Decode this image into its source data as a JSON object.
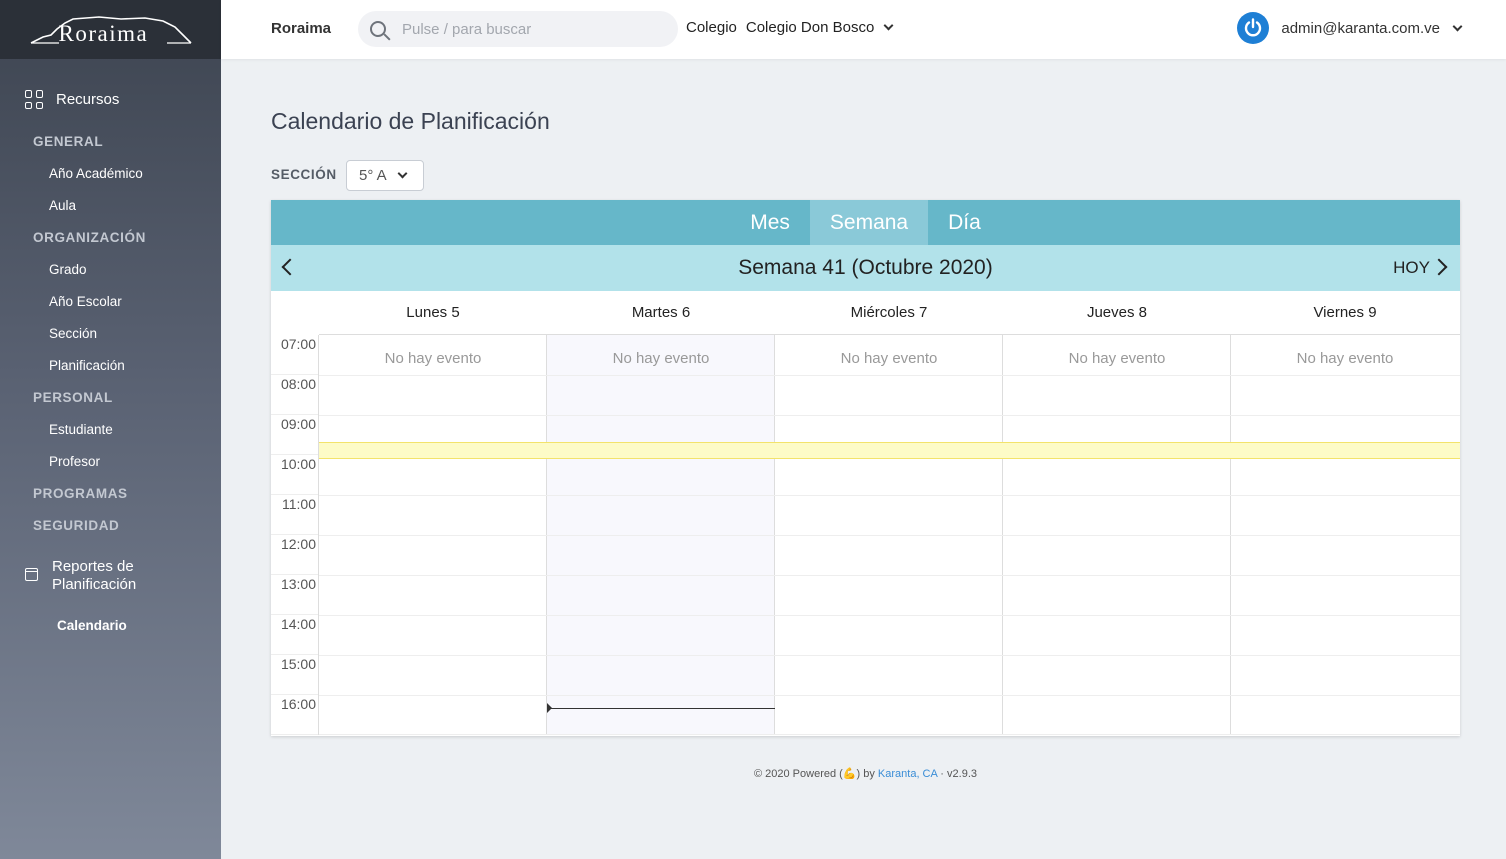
{
  "brand": {
    "name": "Roraima"
  },
  "sidebar": {
    "resources_label": "Recursos",
    "sections": {
      "general": "GENERAL",
      "organizacion": "ORGANIZACIÓN",
      "personal": "PERSONAL",
      "programas": "PROGRAMAS",
      "seguridad": "SEGURIDAD"
    },
    "items": {
      "ano_academico": "Año Académico",
      "aula": "Aula",
      "grado": "Grado",
      "ano_escolar": "Año Escolar",
      "seccion": "Sección",
      "planificacion": "Planificación",
      "estudiante": "Estudiante",
      "profesor": "Profesor"
    },
    "reportes_line1": "Reportes de",
    "reportes_line2": "Planificación",
    "active_item": "Calendario"
  },
  "header": {
    "app_name": "Roraima",
    "search_placeholder": "Pulse / para buscar",
    "colegio_label": "Colegio",
    "colegio_value": "Colegio Don Bosco",
    "user_email": "admin@karanta.com.ve"
  },
  "main": {
    "title": "Calendario de Planificación",
    "section_label": "SECCIÓN",
    "section_value": "5° A"
  },
  "calendar": {
    "views": [
      "Mes",
      "Semana",
      "Día"
    ],
    "active_view": "Semana",
    "week_title": "Semana 41 (Octubre 2020)",
    "today_label": "HOY",
    "days": [
      "Lunes 5",
      "Martes 6",
      "Miércoles 7",
      "Jueves 8",
      "Viernes 9"
    ],
    "hours": [
      "07:00",
      "08:00",
      "09:00",
      "10:00",
      "11:00",
      "12:00",
      "13:00",
      "14:00",
      "15:00",
      "16:00"
    ],
    "no_event_text": "No hay evento"
  },
  "footer": {
    "text_before": "© 2020 Powered (",
    "emoji": "💪",
    "text_mid": ") by ",
    "link": "Karanta, CA",
    "separator": " · ",
    "version": "v2.9.3"
  }
}
